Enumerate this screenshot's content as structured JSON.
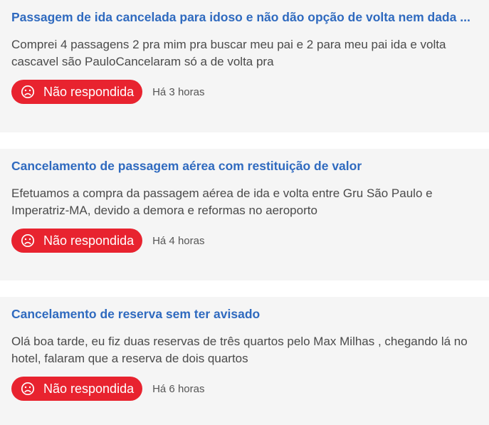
{
  "complaints": [
    {
      "title": "Passagem de ida cancelada para idoso e não dão opção de volta nem dada ...",
      "description": "Comprei 4 passagens 2 pra mim pra buscar meu pai e 2 para meu pai ida e volta cascavel são PauloCancelaram só a de volta pra",
      "status": "Não respondida",
      "time": "Há 3 horas",
      "status_icon": "sad-face-icon"
    },
    {
      "title": "Cancelamento de passagem aérea com restituição de valor",
      "description": "Efetuamos a compra da passagem aérea de ida e volta entre Gru São Paulo e Imperatriz-MA, devido a demora e reformas no aeroporto",
      "status": "Não respondida",
      "time": "Há 4 horas",
      "status_icon": "sad-face-icon"
    },
    {
      "title": "Cancelamento de reserva sem ter avisado",
      "description": "Olá boa tarde, eu fiz duas reservas de três quartos pelo Max Milhas , chegando lá no hotel, falaram que a reserva de dois quartos",
      "status": "Não respondida",
      "time": "Há 6 horas",
      "status_icon": "sad-face-icon"
    }
  ],
  "colors": {
    "title": "#2f6abf",
    "badge_bg": "#e8232f",
    "card_bg": "#f5f5f5",
    "text": "#4a4a4a"
  }
}
